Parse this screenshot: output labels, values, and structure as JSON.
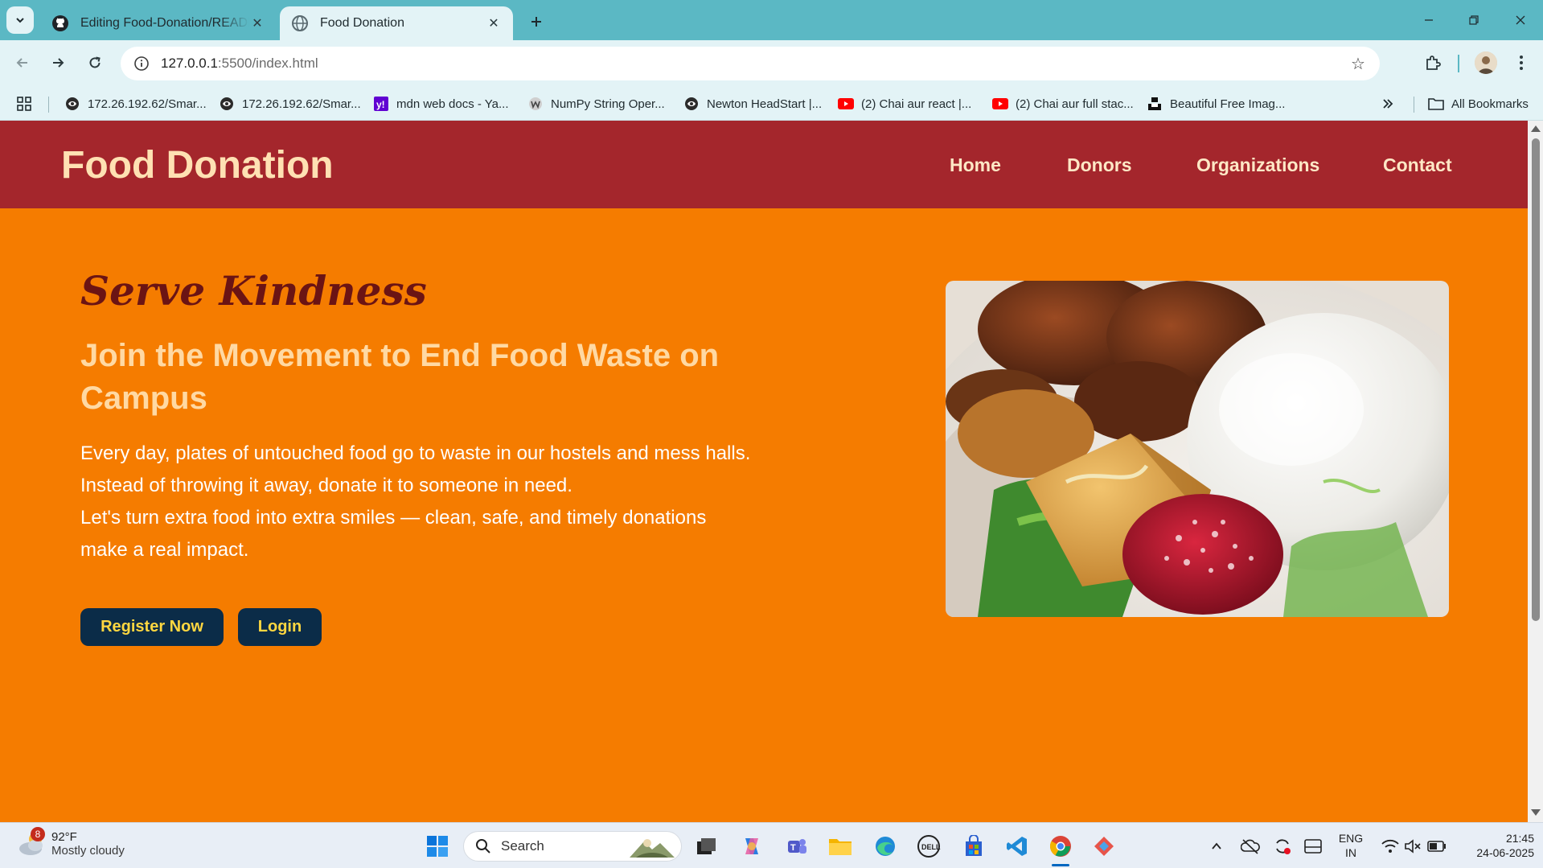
{
  "browser": {
    "tabs": [
      {
        "title": "Editing Food-Donation/README.md",
        "active": false
      },
      {
        "title": "Food Donation",
        "active": true
      }
    ],
    "url_host": "127.0.0.1",
    "url_rest": ":5500/index.html",
    "bookmarks": [
      {
        "label": "172.26.192.62/Smar..."
      },
      {
        "label": "172.26.192.62/Smar..."
      },
      {
        "label": "mdn web docs - Ya..."
      },
      {
        "label": "NumPy String Oper..."
      },
      {
        "label": "Newton HeadStart |..."
      },
      {
        "label": "(2) Chai aur react |..."
      },
      {
        "label": "(2) Chai aur full stac..."
      },
      {
        "label": "Beautiful Free Imag..."
      }
    ],
    "all_bookmarks": "All Bookmarks"
  },
  "site": {
    "logo": "Food Donation",
    "nav": [
      "Home",
      "Donors",
      "Organizations",
      "Contact"
    ],
    "hero": {
      "tagline": "Serve Kindness",
      "heading": "Join the Movement to End Food Waste on Campus",
      "paragraph_lines": [
        "Every day, plates of untouched food go to waste in our hostels and mess halls.",
        "Instead of throwing it away, donate it to someone in need.",
        "Let's turn extra food into extra smiles — clean, safe, and timely donations make a real impact."
      ],
      "register_label": "Register Now",
      "login_label": "Login"
    },
    "colors": {
      "header": "#a4262c",
      "background": "#f57c00",
      "button": "#0b2c48",
      "button_text": "#ffd740"
    }
  },
  "taskbar": {
    "weather_temp": "92°F",
    "weather_cond": "Mostly cloudy",
    "weather_badge": "8",
    "search_label": "Search",
    "lang_top": "ENG",
    "lang_bottom": "IN",
    "time": "21:45",
    "date": "24-06-2025"
  }
}
